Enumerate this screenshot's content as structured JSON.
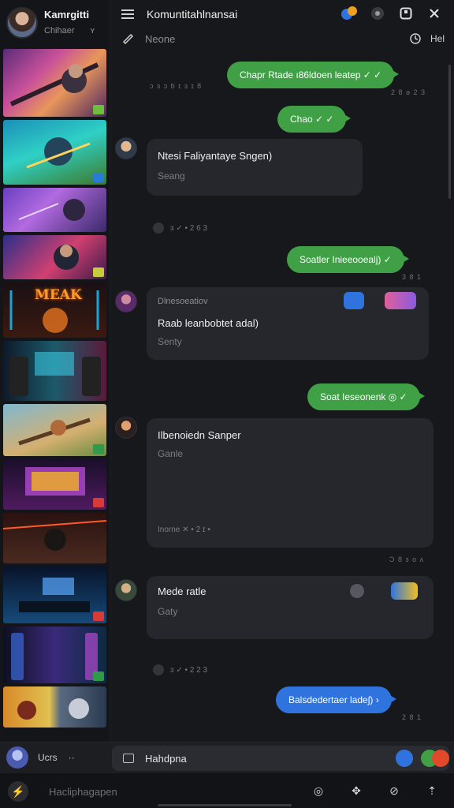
{
  "profile": {
    "name": "Kamrgitti",
    "status": "Chihaer",
    "status_mark": "ʏ"
  },
  "header": {
    "title": "Komuntitahlnansai",
    "subtitle": "Neone",
    "right_label": "Hel"
  },
  "messages": {
    "out1": {
      "text": "Chapr Rtade ı86ldoen leatep ✓ ✓",
      "time": "2 8 ə 2 3"
    },
    "meta1": "ɔ ɜ ɔ ɓ ɪ ɜ ɪ 8",
    "out2": {
      "text": "Chao ✓ ✓"
    },
    "card1": {
      "title": "Ntesi Faliyantaye Sngen)",
      "sub": "Seang"
    },
    "sep1": "ɜ ✓ • 2 6 3",
    "out3": {
      "text": "Soatler Inieeooealj) ✓",
      "time": "3 8 1"
    },
    "card2": {
      "pre": "Dlnesoeatiov",
      "title": "Raab leanbobtet adal)",
      "sub": "Senty"
    },
    "out4": {
      "text": "Soat Ieseonenk ◎ ✓"
    },
    "card3": {
      "title": "Ilbenoiedn Sanper",
      "sub": "Ganle",
      "foot": "Inorne ✕ • 2 ɪ •",
      "time": "Ɔ 8 ɜ o ʌ"
    },
    "card4": {
      "title": "Mede ratle",
      "sub": "Gaty"
    },
    "sep2": "ɜ ✓ • 2 2 3",
    "out5": {
      "text": "Balsdedertaer ladeʃ) ›",
      "time": "2 8 1"
    }
  },
  "composer": {
    "label": "Hahdpna",
    "left_label": "Ucrs",
    "left_more": "··"
  },
  "bottom": {
    "placeholder": "Hacliphagapen"
  },
  "colors": {
    "accent_green": "#3fa046",
    "accent_blue": "#2f74de",
    "card": "#26272c",
    "bg": "#17181b"
  }
}
